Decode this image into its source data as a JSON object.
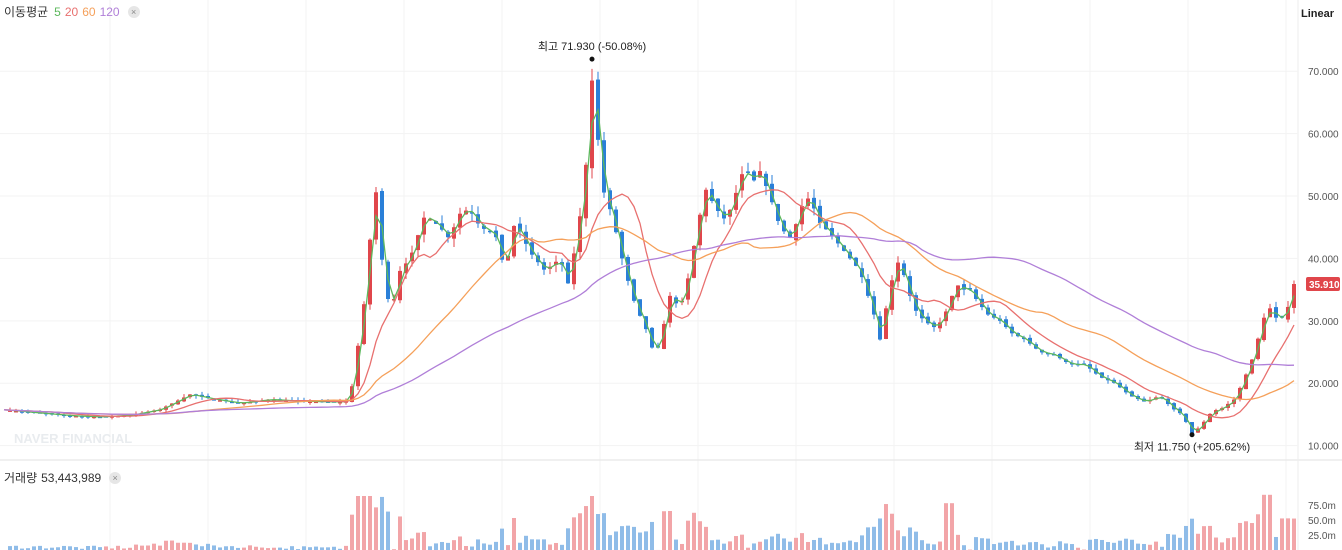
{
  "legend": {
    "title": "이동평균",
    "periods": [
      {
        "label": "5",
        "color": "#5cb85c"
      },
      {
        "label": "20",
        "color": "#e8706f"
      },
      {
        "label": "60",
        "color": "#f5a05a"
      },
      {
        "label": "120",
        "color": "#b07fd8"
      }
    ],
    "close_icon": "×"
  },
  "scale_mode": "Linear",
  "volume_legend": {
    "label": "거래량",
    "value": "53,443,989",
    "close_icon": "×"
  },
  "watermark": "NAVER FINANCIAL",
  "colors": {
    "up": "#e0464b",
    "down": "#2a7fd8",
    "vol_up": "#f2a5a8",
    "vol_down": "#8fbce8",
    "current_badge": "#e0464b"
  },
  "chart_data": {
    "type": "candlestick",
    "title": "",
    "price_axis": {
      "ticks": [
        "10.000",
        "20.000",
        "30.000",
        "40.000",
        "50.000",
        "60.000",
        "70.000"
      ],
      "ylim": [
        8.5,
        75
      ]
    },
    "volume_axis": {
      "ticks": [
        "25.0m",
        "50.0m",
        "75.0m"
      ],
      "ylim": [
        0,
        100
      ]
    },
    "high_marker": {
      "label": "최고 71.930 (-50.08%)",
      "value": 71.93
    },
    "low_marker": {
      "label": "최저 11.750 (+205.62%)",
      "value": 11.75
    },
    "current_price": {
      "label": "35.910",
      "value": 35.91
    },
    "moving_averages": [
      5,
      20,
      60,
      120
    ],
    "anchors": [
      [
        0,
        15.8
      ],
      [
        40,
        15.2
      ],
      [
        70,
        14.8
      ],
      [
        100,
        14.6
      ],
      [
        130,
        14.9
      ],
      [
        160,
        15.8
      ],
      [
        190,
        18.2
      ],
      [
        215,
        17.4
      ],
      [
        240,
        16.8
      ],
      [
        270,
        17.4
      ],
      [
        300,
        17.1
      ],
      [
        340,
        17.0
      ],
      [
        350,
        17.2
      ],
      [
        355,
        23
      ],
      [
        362,
        30
      ],
      [
        368,
        38
      ],
      [
        374,
        53
      ],
      [
        379,
        47
      ],
      [
        384,
        35
      ],
      [
        392,
        32
      ],
      [
        400,
        38
      ],
      [
        410,
        40
      ],
      [
        425,
        47
      ],
      [
        440,
        45
      ],
      [
        450,
        43
      ],
      [
        458,
        47
      ],
      [
        470,
        48
      ],
      [
        480,
        45
      ],
      [
        495,
        44
      ],
      [
        505,
        38
      ],
      [
        515,
        46
      ],
      [
        530,
        41
      ],
      [
        545,
        38
      ],
      [
        560,
        40
      ],
      [
        568,
        36
      ],
      [
        578,
        44
      ],
      [
        586,
        55
      ],
      [
        590,
        71
      ],
      [
        594,
        66
      ],
      [
        598,
        59
      ],
      [
        603,
        51
      ],
      [
        612,
        47
      ],
      [
        622,
        40
      ],
      [
        632,
        34
      ],
      [
        642,
        30
      ],
      [
        648,
        28
      ],
      [
        655,
        24
      ],
      [
        662,
        28
      ],
      [
        670,
        34
      ],
      [
        680,
        32
      ],
      [
        690,
        38
      ],
      [
        697,
        45
      ],
      [
        706,
        51
      ],
      [
        716,
        48
      ],
      [
        726,
        46
      ],
      [
        735,
        50
      ],
      [
        745,
        55
      ],
      [
        752,
        52
      ],
      [
        760,
        54
      ],
      [
        770,
        50
      ],
      [
        780,
        45
      ],
      [
        792,
        43
      ],
      [
        800,
        48
      ],
      [
        810,
        50
      ],
      [
        818,
        46
      ],
      [
        830,
        44
      ],
      [
        840,
        42
      ],
      [
        850,
        40
      ],
      [
        860,
        38
      ],
      [
        868,
        34
      ],
      [
        874,
        31
      ],
      [
        880,
        27
      ],
      [
        886,
        32
      ],
      [
        894,
        38
      ],
      [
        900,
        40
      ],
      [
        906,
        36
      ],
      [
        914,
        32
      ],
      [
        924,
        30
      ],
      [
        934,
        29
      ],
      [
        942,
        30
      ],
      [
        950,
        33
      ],
      [
        956,
        36
      ],
      [
        962,
        35
      ],
      [
        970,
        35
      ],
      [
        978,
        33
      ],
      [
        988,
        31
      ],
      [
        1000,
        30
      ],
      [
        1012,
        28
      ],
      [
        1025,
        27
      ],
      [
        1040,
        25
      ],
      [
        1055,
        24.5
      ],
      [
        1070,
        23
      ],
      [
        1085,
        23
      ],
      [
        1100,
        21
      ],
      [
        1115,
        20
      ],
      [
        1130,
        18
      ],
      [
        1145,
        17
      ],
      [
        1160,
        18
      ],
      [
        1172,
        16
      ],
      [
        1182,
        15
      ],
      [
        1192,
        12
      ],
      [
        1200,
        13
      ],
      [
        1212,
        15.5
      ],
      [
        1222,
        16
      ],
      [
        1235,
        17.5
      ],
      [
        1245,
        21
      ],
      [
        1255,
        25
      ],
      [
        1262,
        30
      ],
      [
        1270,
        32
      ],
      [
        1278,
        30
      ],
      [
        1286,
        31
      ],
      [
        1294,
        35.9
      ]
    ]
  }
}
